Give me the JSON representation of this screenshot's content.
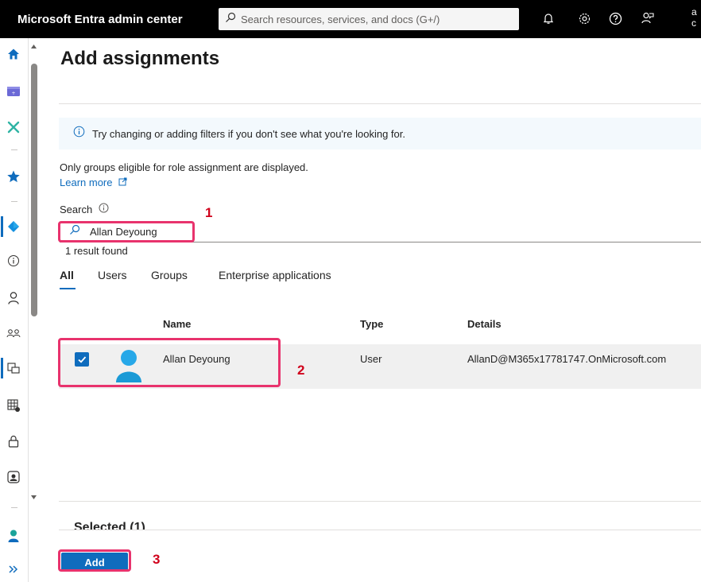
{
  "topbar": {
    "title": "Microsoft Entra admin center",
    "search_placeholder": "Search resources, services, and docs (G+/)",
    "account_line1": "a",
    "account_line2": "c"
  },
  "page": {
    "title": "Add assignments",
    "info_message": "Try changing or adding filters if you don't see what you're looking for.",
    "eligible_note": "Only groups eligible for role assignment are displayed.",
    "learn_more": "Learn more",
    "search_label": "Search",
    "search_value": "Allan Deyoung",
    "result_count": "1 result found",
    "tabs": [
      {
        "label": "All",
        "active": true
      },
      {
        "label": "Users",
        "active": false
      },
      {
        "label": "Groups",
        "active": false
      },
      {
        "label": "Enterprise applications",
        "active": false
      }
    ],
    "columns": {
      "name": "Name",
      "type": "Type",
      "details": "Details"
    },
    "rows": [
      {
        "name": "Allan Deyoung",
        "type": "User",
        "details": "AllanD@M365x17781747.OnMicrosoft.com",
        "checked": true
      }
    ],
    "selected_label": "Selected (1)",
    "add_button": "Add"
  },
  "annotations": {
    "step1": "1",
    "step2": "2",
    "step3": "3",
    "highlight_color": "#e8336d",
    "number_color": "#d0021b"
  },
  "colors": {
    "accent": "#0f6cbd",
    "topbar": "#000000",
    "info_bg": "#f3f9fd"
  },
  "nav_icons": [
    "home-icon",
    "dashboard-icon",
    "tools-icon",
    "favorites-star-icon",
    "entra-diamond-icon",
    "info-circle-icon",
    "user-icon",
    "groups-icon",
    "applications-icon",
    "grid-icon",
    "lock-icon",
    "identity-governance-icon",
    "user-profile-icon",
    "expand-chevrons-icon"
  ]
}
